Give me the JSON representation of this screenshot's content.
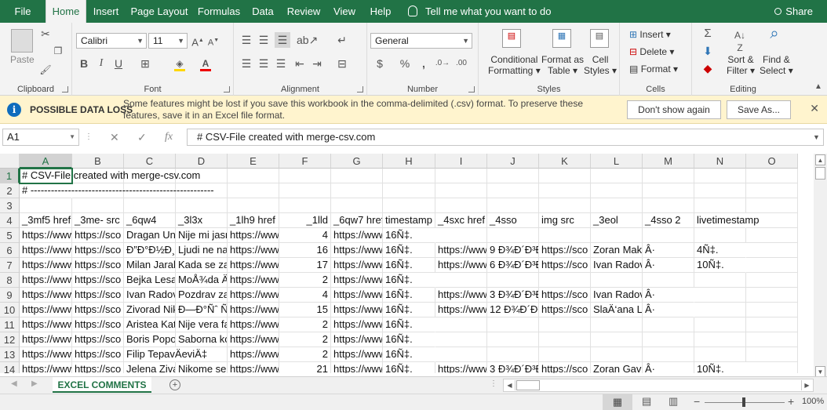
{
  "menu": {
    "tabs": [
      "File",
      "Home",
      "Insert",
      "Page Layout",
      "Formulas",
      "Data",
      "Review",
      "View",
      "Help"
    ],
    "active_tab": "Home",
    "tell_me": "Tell me what you want to do",
    "share": "Share"
  },
  "ribbon": {
    "clipboard": {
      "label": "Clipboard",
      "paste": "Paste"
    },
    "font": {
      "label": "Font",
      "family": "Calibri",
      "size": "11"
    },
    "alignment": {
      "label": "Alignment"
    },
    "number": {
      "label": "Number",
      "format": "General"
    },
    "styles": {
      "label": "Styles",
      "conditional": "Conditional",
      "formatting": "Formatting",
      "format_as": "Format as",
      "table": "Table",
      "cell": "Cell",
      "cell_styles": "Styles"
    },
    "cells": {
      "label": "Cells",
      "insert": "Insert",
      "delete": "Delete",
      "format": "Format"
    },
    "editing": {
      "label": "Editing",
      "sort": "Sort &",
      "filter": "Filter",
      "find": "Find &",
      "select": "Select"
    }
  },
  "message_bar": {
    "title": "POSSIBLE DATA LOSS",
    "text": "Some features might be lost if you save this workbook in the comma-delimited (.csv) format. To preserve these features, save it in an Excel file format.",
    "dont_show": "Don't show again",
    "save_as": "Save As..."
  },
  "formula_bar": {
    "name_box": "A1",
    "formula": "# CSV-File created with merge-csv.com"
  },
  "columns": [
    "A",
    "B",
    "C",
    "D",
    "E",
    "F",
    "G",
    "H",
    "I",
    "J",
    "K",
    "L",
    "M",
    "N",
    "O"
  ],
  "rows": [
    {
      "n": "1",
      "cells": {
        "A": "# CSV-File created with merge-csv.com"
      }
    },
    {
      "n": "2",
      "cells": {
        "A": "# ------------------------------------------------------"
      }
    },
    {
      "n": "3",
      "cells": {}
    },
    {
      "n": "4",
      "cells": {
        "A": "_3mf5 href",
        "B": "_3me- src",
        "C": "_6qw4",
        "D": "_3l3x",
        "E": "_1lh9 href",
        "F": "_1lld",
        "G": "_6qw7 href",
        "H": "timestamp",
        "I": "_4sxc href",
        "J": "_4sso",
        "K": "img src",
        "L": "_3eol",
        "M": "_4sso 2",
        "N": "livetimestamp"
      }
    },
    {
      "n": "5",
      "cells": {
        "A": "https://www",
        "B": "https://sco",
        "C": "Dragan Unj",
        "D": "Nije mi jasno",
        "E": "https://www",
        "F": "4",
        "G": "https://www",
        "H": "16Ñ‡."
      }
    },
    {
      "n": "6",
      "cells": {
        "A": "https://www",
        "B": "https://sco",
        "C": "Ð”Ð°Ð½Ð¸",
        "D": "Ljudi ne na",
        "E": "https://www",
        "F": "16",
        "G": "https://www",
        "H": "16Ñ‡.",
        "I": "https://www",
        "J": "9 Ð¾Ð´Ð³Ð",
        "K": "https://sco",
        "L": "Zoran Maks",
        "M": "Â·",
        "N": "4Ñ‡."
      }
    },
    {
      "n": "7",
      "cells": {
        "A": "https://www",
        "B": "https://sco",
        "C": "Milan Jarak",
        "D": "Kada se zav",
        "E": "https://www",
        "F": "17",
        "G": "https://www",
        "H": "16Ñ‡.",
        "I": "https://www",
        "J": "6 Ð¾Ð´Ð³Ð",
        "K": "https://sco",
        "L": "Ivan Radov",
        "M": "Â·",
        "N": "10Ñ‡."
      }
    },
    {
      "n": "8",
      "cells": {
        "A": "https://www",
        "B": "https://sco",
        "C": "Bejka Lesar",
        "D": "MoÅ¾da Ä",
        "E": "https://www",
        "F": "2",
        "G": "https://www",
        "H": "16Ñ‡."
      }
    },
    {
      "n": "9",
      "cells": {
        "A": "https://www",
        "B": "https://sco",
        "C": "Ivan Radov",
        "D": "Pozdrav za",
        "E": "https://www",
        "F": "4",
        "G": "https://www",
        "H": "16Ñ‡.",
        "I": "https://www",
        "J": "3 Ð¾Ð´Ð³Ð",
        "K": "https://sco",
        "L": "Ivan Radov",
        "M": "Â·"
      }
    },
    {
      "n": "10",
      "cells": {
        "A": "https://www",
        "B": "https://sco",
        "C": "Zivorad Nik",
        "D": "Ð—Ð°Ñˆ Ñ",
        "E": "https://www",
        "F": "15",
        "G": "https://www",
        "H": "16Ñ‡.",
        "I": "https://www",
        "J": "12 Ð¾Ð´Ð³",
        "K": "https://sco",
        "L": "SlaÄ‘ana Lj",
        "M": "Â·"
      }
    },
    {
      "n": "11",
      "cells": {
        "A": "https://www",
        "B": "https://sco",
        "C": "Aristea Kat",
        "D": "Nije vera fa",
        "E": "https://www",
        "F": "2",
        "G": "https://www",
        "H": "16Ñ‡."
      }
    },
    {
      "n": "12",
      "cells": {
        "A": "https://www",
        "B": "https://sco",
        "C": "Boris Popo",
        "D": "Saborna kc",
        "E": "https://www",
        "F": "2",
        "G": "https://www",
        "H": "16Ñ‡."
      }
    },
    {
      "n": "13",
      "cells": {
        "A": "https://www",
        "B": "https://sco",
        "C": "Filip TepavÄeviÄ‡",
        "E": "https://www",
        "F": "2",
        "G": "https://www",
        "H": "16Ñ‡."
      }
    },
    {
      "n": "14",
      "cells": {
        "A": "https://www",
        "B": "https://sco",
        "C": "Jelena Ziva",
        "D": "Nikome se",
        "E": "https://www",
        "F": "21",
        "G": "https://www",
        "H": "16Ñ‡.",
        "I": "https://www",
        "J": "3 Ð¾Ð´Ð³Ð",
        "K": "https://sco",
        "L": "Zoran Gavr",
        "M": "Â·",
        "N": "10Ñ‡."
      }
    }
  ],
  "numeric_columns": [
    "F"
  ],
  "sheet": {
    "name": "EXCEL COMMENTS"
  },
  "status": {
    "zoom": "100%"
  },
  "colors": {
    "accent": "#217346",
    "message_bg": "#fff4ce"
  }
}
